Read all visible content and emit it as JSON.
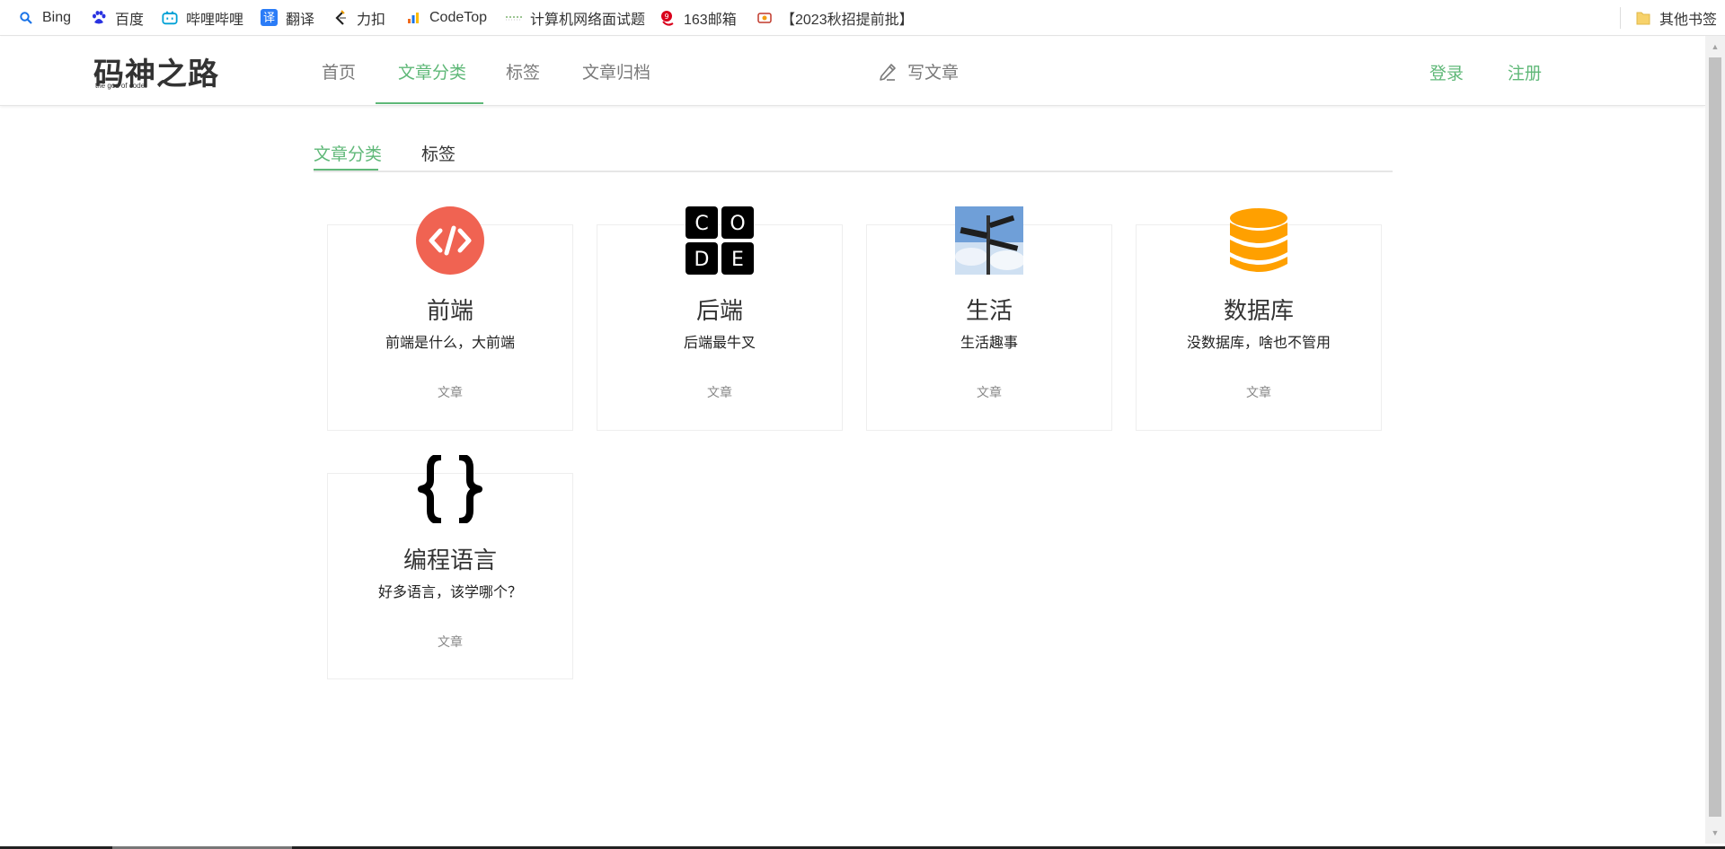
{
  "bookmarks": [
    {
      "label": "Bing",
      "icon": "bing-search-icon"
    },
    {
      "label": "百度",
      "icon": "baidu-paw-icon"
    },
    {
      "label": "哔哩哔哩",
      "icon": "bilibili-tv-icon"
    },
    {
      "label": "翻译",
      "icon": "translate-icon"
    },
    {
      "label": "力扣",
      "icon": "leetcode-icon"
    },
    {
      "label": "CodeTop",
      "icon": "bar-chart-icon"
    },
    {
      "label": "计算机网络面试题",
      "icon": "dotted-line-icon"
    },
    {
      "label": "163邮箱",
      "icon": "mail-163-icon"
    },
    {
      "label": "【2023秋招提前批】",
      "icon": "page-icon"
    },
    {
      "label": "其他书签",
      "icon": "folder-icon"
    }
  ],
  "logo": {
    "text": "码神之路",
    "subtitle": "the god of code!"
  },
  "nav": {
    "items": [
      "首页",
      "文章分类",
      "标签",
      "文章归档"
    ],
    "write": "写文章",
    "login": "登录",
    "register": "注册"
  },
  "subtabs": [
    "文章分类",
    "标签"
  ],
  "categories": [
    {
      "title": "前端",
      "desc": "前端是什么，大前端",
      "meta": "文章",
      "icon": "frontend-code-icon"
    },
    {
      "title": "后端",
      "desc": "后端最牛叉",
      "meta": "文章",
      "icon": "code-blocks-icon"
    },
    {
      "title": "生活",
      "desc": "生活趣事",
      "meta": "文章",
      "icon": "signpost-photo-icon"
    },
    {
      "title": "数据库",
      "desc": "没数据库，啥也不管用",
      "meta": "文章",
      "icon": "database-icon"
    },
    {
      "title": "编程语言",
      "desc": "好多语言，该学哪个？",
      "meta": "文章",
      "icon": "curly-braces-icon"
    }
  ],
  "colors": {
    "accent": "#5fb878",
    "frontend": "#f06352",
    "database": "#ffa000"
  }
}
